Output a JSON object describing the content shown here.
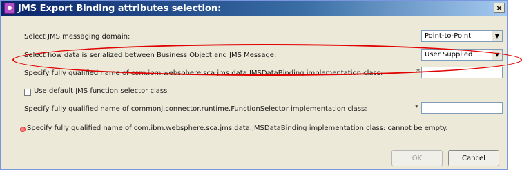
{
  "window": {
    "title": "JMS Export Binding attributes selection:"
  },
  "form": {
    "domain_label": "Select JMS messaging domain:",
    "domain_value": "Point-to-Point",
    "serialize_label": "Select how data is serialized between Business Object and JMS Message:",
    "serialize_value": "User Supplied",
    "databinding_label": "Specify fully qualified name of com.ibm.websphere.sca.jms.data.JMSDataBinding implementation class:",
    "databinding_required": "*",
    "databinding_value": "",
    "default_selector_label": "Use default JMS function selector class",
    "selector_label": "Specify fully qualified name of commonj.connector.runtime.FunctionSelector implementation class:",
    "selector_required": "*",
    "selector_value": "",
    "error_message": "Specify fully qualified name of com.ibm.websphere.sca.jms.data.JMSDataBinding implementation class: cannot be empty."
  },
  "buttons": {
    "ok": "OK",
    "cancel": "Cancel"
  },
  "icons": {
    "combo_arrow": "▼",
    "close": "×",
    "title_icon": "◆"
  },
  "colors": {
    "highlight": "#e10000",
    "error": "#ff7a7a"
  }
}
